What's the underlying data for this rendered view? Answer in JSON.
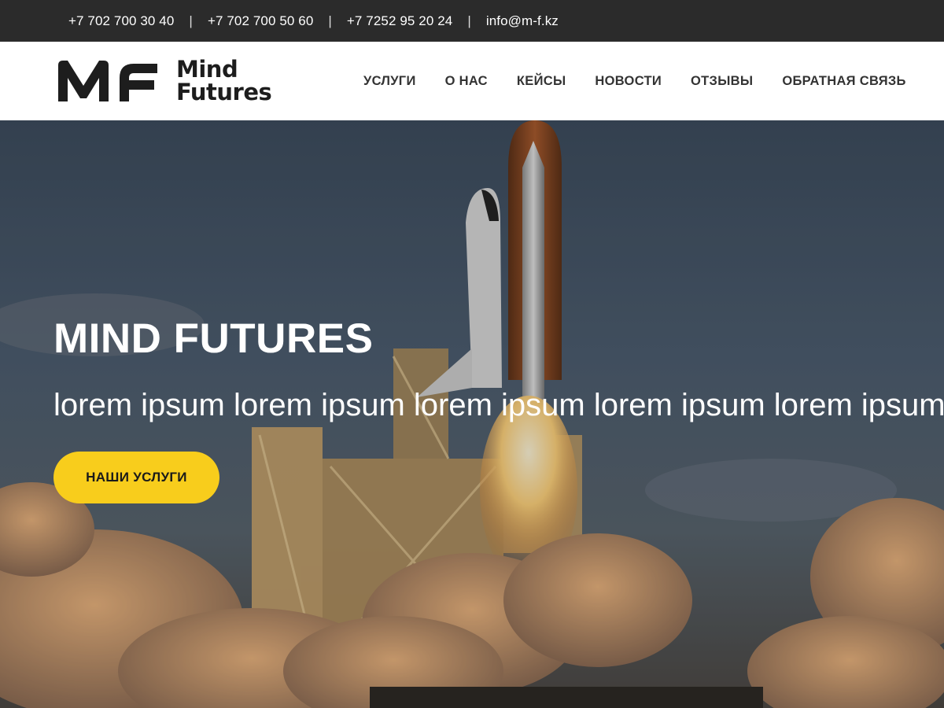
{
  "topbar": {
    "phone1": "+7 702 700 30 40",
    "phone2": "+7 702 700 50 60",
    "phone3": "+7 7252 95 20 24",
    "email": "info@m-f.kz",
    "separator": "|"
  },
  "header": {
    "logo_line1": "Mind",
    "logo_line2": "Futures",
    "nav": [
      "УСЛУГИ",
      "О НАС",
      "КЕЙСЫ",
      "НОВОСТИ",
      "ОТЗЫВЫ",
      "ОБРАТНАЯ СВЯЗЬ"
    ]
  },
  "hero": {
    "title": "MIND FUTURES",
    "subtitle": "lorem ipsum lorem ipsum lorem ipsum lorem ipsum lorem ipsum",
    "button_label": "НАШИ УСЛУГИ",
    "background_icon": "space-shuttle-launch-image"
  },
  "colors": {
    "topbar_bg": "#2b2b2b",
    "accent": "#f8cd1c",
    "nav_text": "#333333"
  }
}
